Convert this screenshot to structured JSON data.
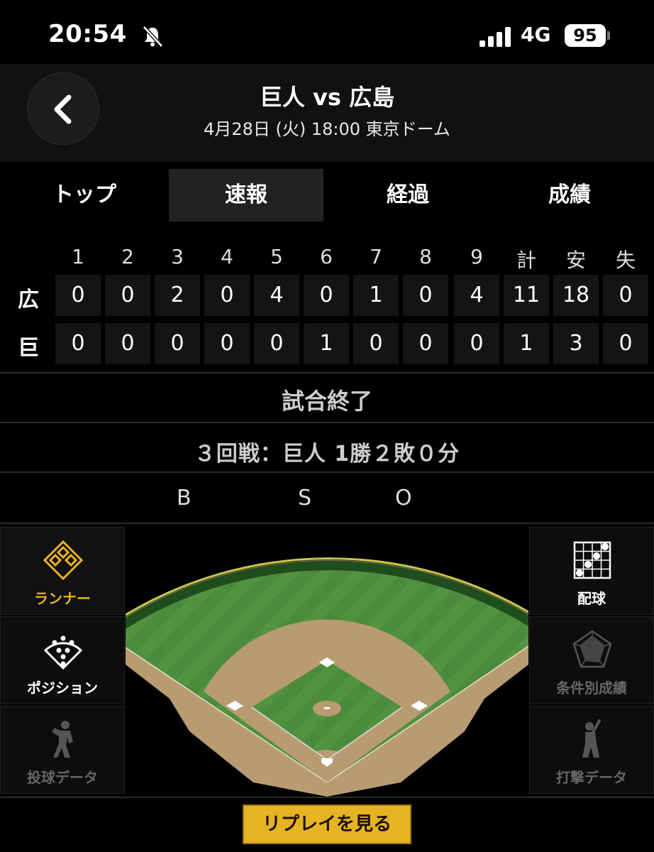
{
  "status_bar": {
    "time": "20:54",
    "network": "4G",
    "battery": "95"
  },
  "header": {
    "title": "巨人 vs 広島",
    "subtitle": "4月28日 (火) 18:00 東京ドーム"
  },
  "tabs": [
    {
      "label": "トップ",
      "active": false
    },
    {
      "label": "速報",
      "active": true
    },
    {
      "label": "経過",
      "active": false
    },
    {
      "label": "成績",
      "active": false
    }
  ],
  "scoreboard": {
    "columns": [
      "1",
      "2",
      "3",
      "4",
      "5",
      "6",
      "7",
      "8",
      "9",
      "計",
      "安",
      "失"
    ],
    "rows": [
      {
        "team": "広",
        "values": [
          "0",
          "0",
          "2",
          "0",
          "4",
          "0",
          "1",
          "0",
          "4",
          "11",
          "18",
          "0"
        ]
      },
      {
        "team": "巨",
        "values": [
          "0",
          "0",
          "0",
          "0",
          "0",
          "1",
          "0",
          "0",
          "0",
          "1",
          "3",
          "0"
        ]
      }
    ]
  },
  "game_status": "試合終了",
  "series_record": "３回戦：巨人 1勝２敗０分",
  "count": {
    "b": "B",
    "s": "S",
    "o": "O"
  },
  "left_panel": [
    {
      "label": "ランナー",
      "icon": "runner-diamond-icon",
      "active": true
    },
    {
      "label": "ポジション",
      "icon": "position-icon",
      "active": false
    },
    {
      "label": "投球データ",
      "icon": "pitcher-icon",
      "active": false
    }
  ],
  "right_panel": [
    {
      "label": "配球",
      "icon": "pitch-grid-icon",
      "active": false
    },
    {
      "label": "条件別成績",
      "icon": "radar-chart-icon",
      "active": false
    },
    {
      "label": "打撃データ",
      "icon": "batter-icon",
      "active": false
    }
  ],
  "replay_button": "リプレイを見る",
  "colors": {
    "accent": "#e6b422",
    "field_grass": "#4d8c3d",
    "infield_dirt": "#b99b72",
    "dim_text": "#666666"
  }
}
